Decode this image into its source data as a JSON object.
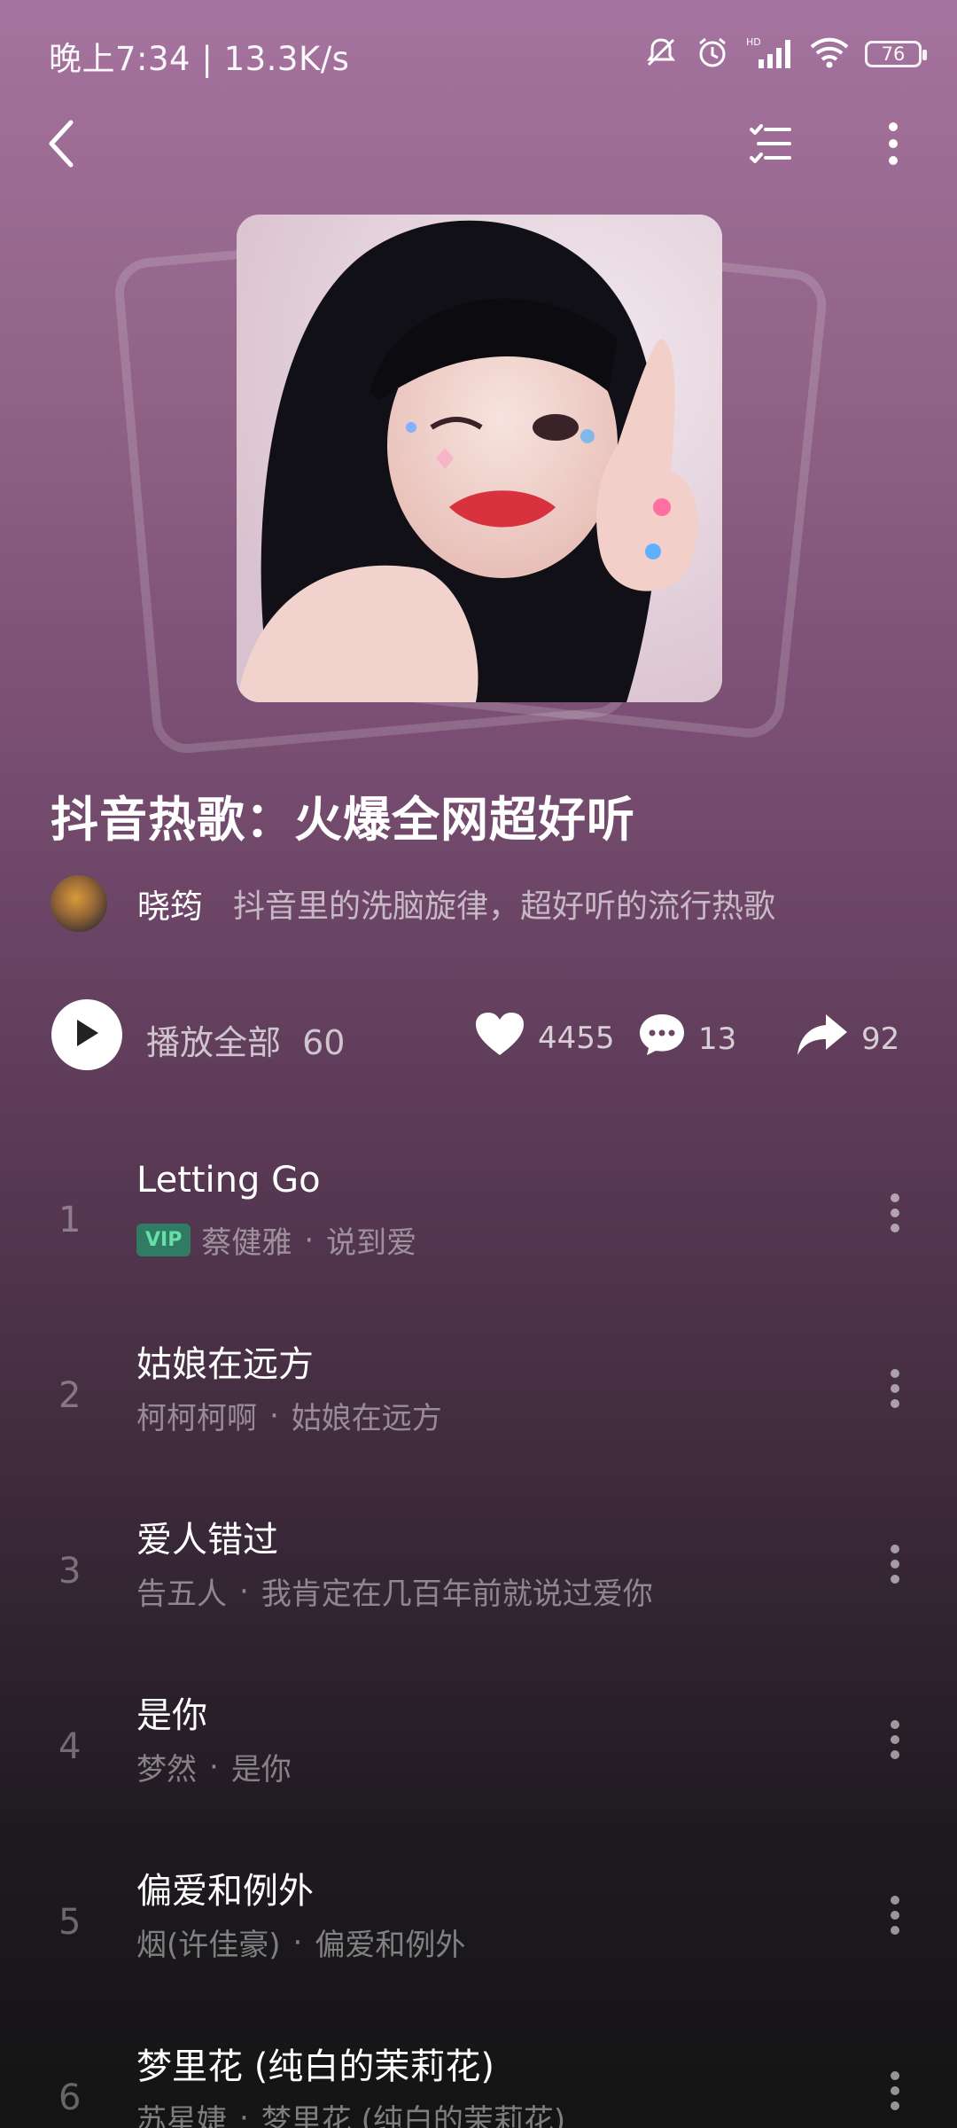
{
  "status_bar": {
    "time": "晚上7:34 | 13.3K/s",
    "battery": "76",
    "icons": [
      "mute-bell-icon",
      "alarm-icon",
      "hd-signal-icon",
      "wifi-icon",
      "battery-icon"
    ]
  },
  "nav": {
    "back_icon": "back-arrow-icon",
    "list_icon": "checklist-icon",
    "more_icon": "more-vertical-icon"
  },
  "playlist": {
    "title": "抖音热歌：火爆全网超好听",
    "author": "晓筠",
    "description": "抖音里的洗脑旋律，超好听的流行热歌"
  },
  "actions": {
    "play_all_label": "播放全部",
    "count": "60",
    "likes": "4455",
    "comments": "13",
    "shares": "92"
  },
  "songs": [
    {
      "index": "1",
      "title": "Letting Go",
      "vip": "VIP",
      "artist": "蔡健雅",
      "album": "说到爱"
    },
    {
      "index": "2",
      "title": "姑娘在远方",
      "artist": "柯柯柯啊",
      "album": "姑娘在远方"
    },
    {
      "index": "3",
      "title": "爱人错过",
      "artist": "告五人",
      "album": "我肯定在几百年前就说过爱你"
    },
    {
      "index": "4",
      "title": "是你",
      "artist": "梦然",
      "album": "是你"
    },
    {
      "index": "5",
      "title": "偏爱和例外",
      "artist": "烟(许佳豪)",
      "album": "偏爱和例外"
    },
    {
      "index": "6",
      "title": "梦里花 (纯白的茉莉花)",
      "artist": "苏星婕",
      "album": "梦里花 (纯白的茉莉花)"
    }
  ],
  "colors": {
    "accent_vip_bg": "#2f7b63",
    "accent_vip_text": "#66e0a5"
  }
}
